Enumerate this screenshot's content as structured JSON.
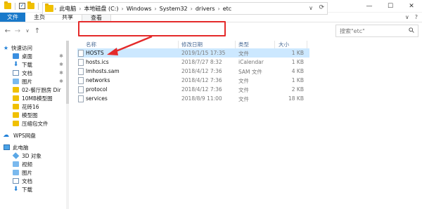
{
  "window": {
    "title": "etc",
    "controls": {
      "minimize": "—",
      "maximize": "☐",
      "close": "✕"
    }
  },
  "ribbon": {
    "tabs": [
      {
        "label": "文件"
      },
      {
        "label": "主页"
      },
      {
        "label": "共享"
      },
      {
        "label": "查看"
      }
    ],
    "right_chevron": "∨",
    "help": "?"
  },
  "nav_buttons": {
    "back": "←",
    "forward": "→",
    "recent": "∨",
    "up": "↑"
  },
  "address": {
    "crumbs": [
      "此电脑",
      "本地磁盘 (C:)",
      "Windows",
      "System32",
      "drivers",
      "etc"
    ],
    "separator": "›",
    "dropdown": "∨",
    "refresh": "⟳"
  },
  "search": {
    "placeholder": "搜索\"etc\"",
    "icon": "search-icon"
  },
  "columns": {
    "name": "名称",
    "date": "修改日期",
    "type": "类型",
    "size": "大小"
  },
  "files": [
    {
      "name": "HOSTS",
      "date": "2019/1/15 17:35",
      "type": "文件",
      "size": "1 KB",
      "selected": true
    },
    {
      "name": "hosts.ics",
      "date": "2018/7/27 8:32",
      "type": "iCalendar",
      "size": "1 KB",
      "selected": false
    },
    {
      "name": "lmhosts.sam",
      "date": "2018/4/12 7:36",
      "type": "SAM 文件",
      "size": "4 KB",
      "selected": false
    },
    {
      "name": "networks",
      "date": "2018/4/12 7:36",
      "type": "文件",
      "size": "1 KB",
      "selected": false
    },
    {
      "name": "protocol",
      "date": "2018/4/12 7:36",
      "type": "文件",
      "size": "2 KB",
      "selected": false
    },
    {
      "name": "services",
      "date": "2018/8/9 11:00",
      "type": "文件",
      "size": "18 KB",
      "selected": false
    }
  ],
  "nav": {
    "quick_access": "快速访问",
    "quick_items": [
      {
        "label": "桌面",
        "pinned": true
      },
      {
        "label": "下载",
        "pinned": true
      },
      {
        "label": "文档",
        "pinned": true
      },
      {
        "label": "图片",
        "pinned": true
      },
      {
        "label": "02-餐厅厨房 Dir",
        "pinned": false
      },
      {
        "label": "10MB模型图",
        "pinned": false
      },
      {
        "label": "花砖16",
        "pinned": false
      },
      {
        "label": "模型图",
        "pinned": false
      },
      {
        "label": "压缩包文件",
        "pinned": false
      }
    ],
    "wps": "WPS网盘",
    "this_pc": "此电脑",
    "pc_items": [
      {
        "label": "3D 对象"
      },
      {
        "label": "视频"
      },
      {
        "label": "图片"
      },
      {
        "label": "文档"
      },
      {
        "label": "下载"
      }
    ],
    "pin_glyph": "✱"
  },
  "colors": {
    "accent": "#1979ca",
    "selection": "#cce8ff",
    "annotation": "#e42a2a"
  }
}
